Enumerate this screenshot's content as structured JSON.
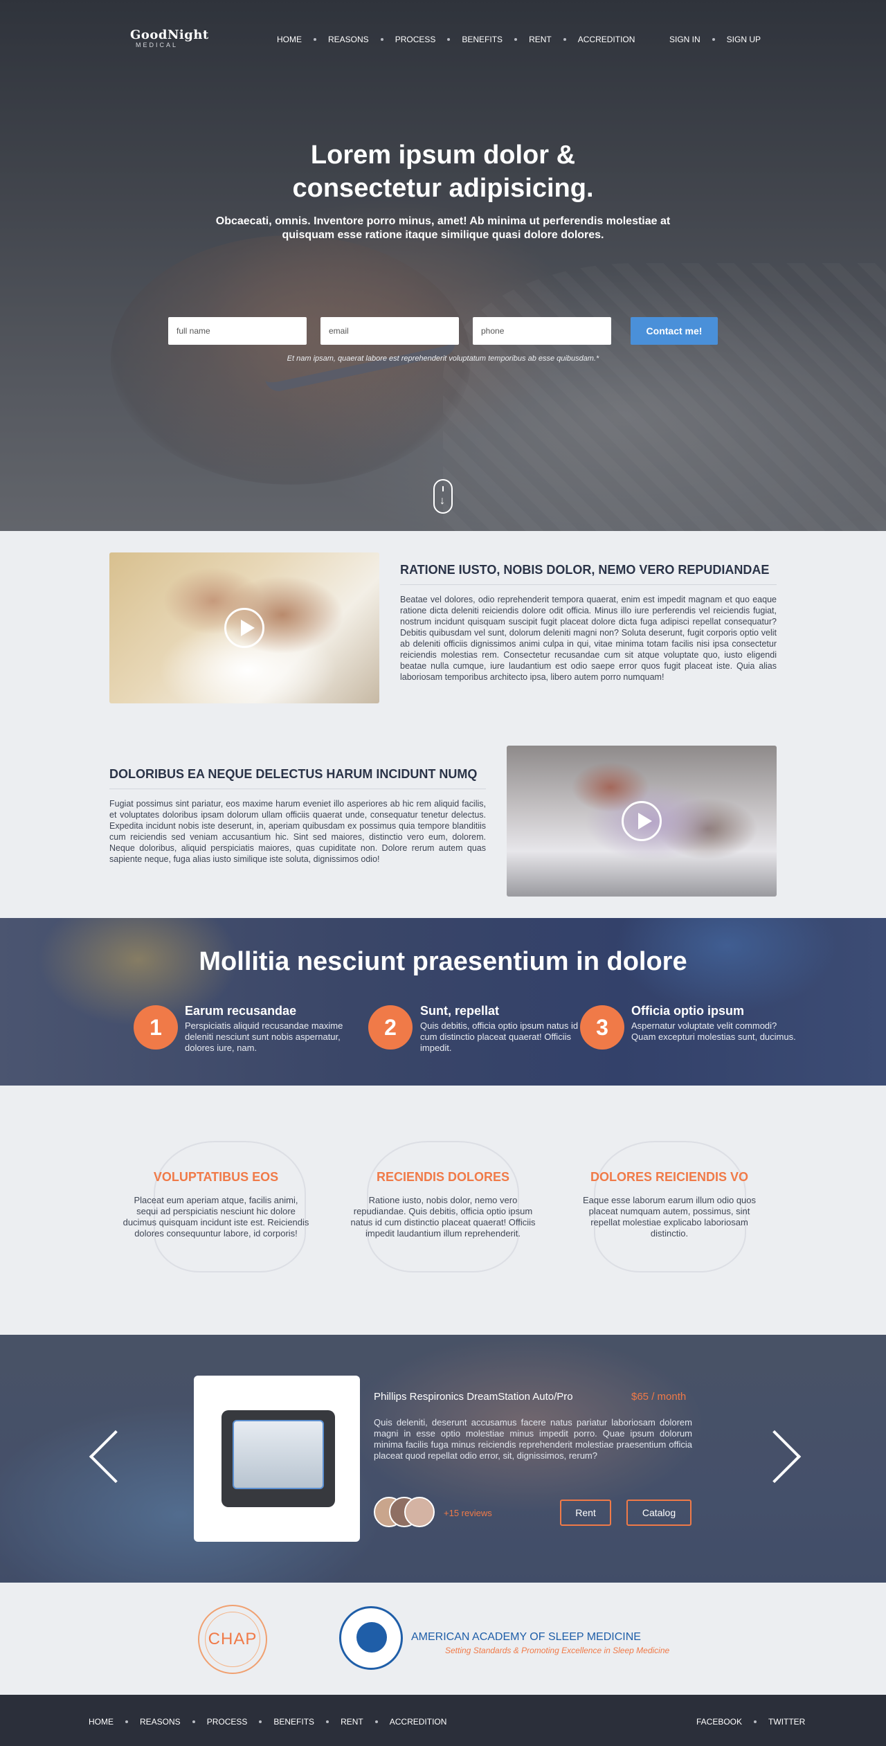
{
  "brand": {
    "name": "GoodNight",
    "sub": "MEDICAL"
  },
  "nav": {
    "items": [
      "HOME",
      "REASONS",
      "PROCESS",
      "BENEFITS",
      "RENT",
      "ACCREDITION"
    ],
    "auth": [
      "SIGN IN",
      "SIGN UP"
    ]
  },
  "hero": {
    "title_line1": "Lorem ipsum dolor  &",
    "title_line2": "consectetur adipisicing.",
    "subtitle": "Obcaecati, omnis. Inventore porro minus, amet! Ab minima ut perferendis molestiae at quisquam esse ratione itaque similique quasi dolore dolores.",
    "form": {
      "fullname_placeholder": "full name",
      "email_placeholder": "email",
      "phone_placeholder": "phone",
      "submit": "Contact me!"
    },
    "note": "Et nam ipsam, quaerat labore est reprehenderit voluptatum temporibus ab esse quibusdam.*",
    "scroll_icon": "mouse-scroll-icon"
  },
  "features": [
    {
      "title": "RATIONE IUSTO, NOBIS DOLOR, NEMO VERO REPUDIANDAE",
      "text": "Beatae vel dolores, odio reprehenderit tempora quaerat, enim est impedit magnam et quo eaque ratione dicta deleniti reiciendis dolore odit officia. Minus illo iure perferendis vel reiciendis fugiat, nostrum incidunt quisquam suscipit fugit placeat dolore dicta fuga adipisci repellat consequatur? Debitis quibusdam vel sunt, dolorum deleniti magni non? Soluta deserunt, fugit corporis optio velit ab deleniti officiis dignissimos animi culpa in qui, vitae minima totam facilis nisi ipsa consectetur reiciendis molestias rem. Consectetur recusandae cum sit atque voluptate quo, iusto eligendi beatae nulla cumque, iure laudantium est odio saepe error quos fugit placeat iste. Quia alias laboriosam temporibus architecto ipsa, libero autem porro numquam!"
    },
    {
      "title": "DOLORIBUS EA NEQUE DELECTUS HARUM INCIDUNT NUMQ",
      "text": "Fugiat possimus sint pariatur, eos maxime harum eveniet illo asperiores ab hic rem aliquid facilis, et voluptates doloribus ipsam dolorum ullam officiis quaerat unde, consequatur tenetur delectus. Expedita incidunt nobis iste deserunt, in, aperiam quibusdam ex possimus quia tempore blanditiis cum reiciendis sed veniam accusantium hic. Sint sed maiores, distinctio vero eum, dolorem. Neque doloribus, aliquid perspiciatis maiores, quas cupiditate non. Dolore rerum autem quas sapiente neque, fuga alias iusto similique iste soluta, dignissimos odio!"
    }
  ],
  "steps": {
    "title": "Mollitia nesciunt praesentium in dolore",
    "items": [
      {
        "num": "1",
        "title": "Earum recusandae",
        "text": "Perspiciatis aliquid recusandae maxime deleniti nesciunt sunt nobis aspernatur, dolores iure, nam."
      },
      {
        "num": "2",
        "title": "Sunt, repellat",
        "text": "Quis debitis, officia optio ipsum natus id cum distinctio placeat quaerat! Officiis impedit."
      },
      {
        "num": "3",
        "title": "Officia optio ipsum",
        "text": "Aspernatur voluptate velit commodi? Quam excepturi molestias sunt, ducimus."
      }
    ]
  },
  "tri": [
    {
      "title": "VOLUPTATIBUS EOS",
      "text": "Placeat eum aperiam atque, facilis animi, sequi ad perspiciatis nesciunt hic dolore ducimus quisquam incidunt iste est. Reiciendis dolores consequuntur labore, id corporis!"
    },
    {
      "title": "RECIENDIS DOLORES",
      "text": "Ratione iusto, nobis dolor, nemo vero repudiandae. Quis debitis, officia optio ipsum natus id cum distinctio placeat quaerat! Officiis impedit laudantium illum reprehenderit."
    },
    {
      "title": "DOLORES REICIENDIS VO",
      "text": "Eaque esse laborum earum illum odio quos placeat numquam autem, possimus, sint repellat molestiae explicabo laboriosam distinctio."
    }
  ],
  "product": {
    "name": "Phillips Respironics DreamStation Auto/Pro",
    "price": "$65 / month",
    "description": "Quis deleniti, deserunt accusamus facere natus pariatur laboriosam dolorem magni in esse optio molestiae minus impedit porro. Quae ipsum dolorum minima facilis fuga minus reiciendis reprehenderit molestiae praesentium officia placeat quod repellat odio error, sit, dignissimos, rerum?",
    "reviews": "+15 reviews",
    "rent": "Rent",
    "catalog": "Catalog"
  },
  "accreditation": {
    "chap": "CHAP",
    "aasm_title": "AMERICAN ACADEMY OF SLEEP MEDICINE",
    "aasm_tagline": "Setting Standards & Promoting Excellence in Sleep Medicine"
  },
  "footer": {
    "items": [
      "HOME",
      "REASONS",
      "PROCESS",
      "BENEFITS",
      "RENT",
      "ACCREDITION"
    ],
    "social": [
      "FACEBOOK",
      "TWITTER"
    ]
  },
  "colors": {
    "accent": "#f07a48",
    "primary_button": "#4a90d9",
    "footer_bg": "#2b2f3a"
  }
}
